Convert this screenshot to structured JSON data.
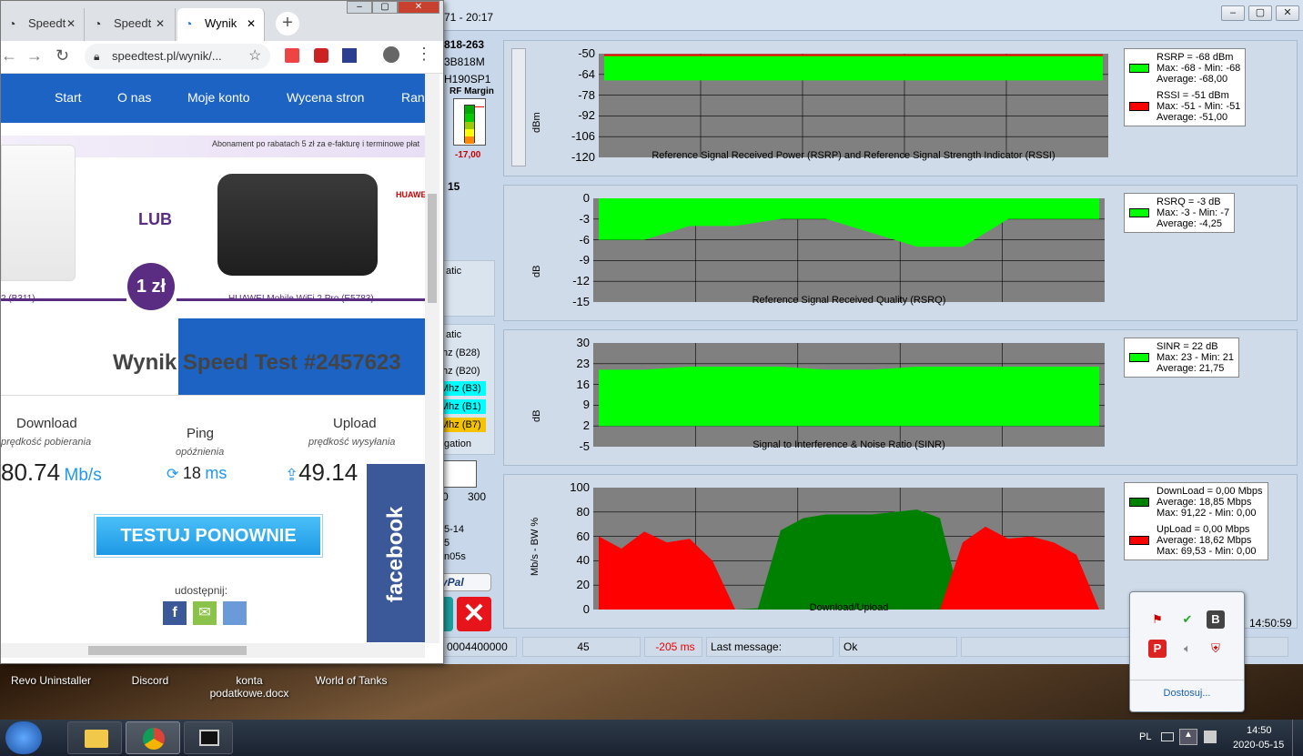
{
  "app": {
    "title": "71 - 20:17",
    "model_id": "818-263",
    "model_a": "3B818M",
    "model_b": "H190SP1",
    "rf_margin_label": "RF Margin",
    "rf_margin_value": "-17,00",
    "side_num": "15",
    "side_atic1": "atic",
    "side_atic2": "atic",
    "band_b28": "hz (B28)",
    "band_b20": "hz (B20)",
    "band_b3": "Mhz (B3)",
    "band_b1": "Mhz (B1)",
    "band_b7": "Mhz (B7)",
    "side_gation": "gation",
    "slider_a": "0",
    "slider_b": "300",
    "side_l1": "5-14",
    "side_l2": "5",
    "side_l3": "n05s",
    "paypal": "yPal",
    "clock": "14:50:59"
  },
  "panels": [
    {
      "ylabel": "dBm",
      "xlabel": "Reference Signal Received Power (RSRP) and Reference Signal Strength Indicator (RSSI)",
      "ticks": [
        "-50",
        "-64",
        "-78",
        "-92",
        "-106",
        "-120"
      ],
      "legend": [
        {
          "color": "#00ff00",
          "l1": "RSRP = -68 dBm",
          "l2": "Max: -68 - Min: -68",
          "l3": "Average: -68,00"
        },
        {
          "color": "#ff0000",
          "l1": "RSSI = -51 dBm",
          "l2": "Max: -51 - Min: -51",
          "l3": "Average: -51,00"
        }
      ]
    },
    {
      "ylabel": "dB",
      "xlabel": "Reference Signal Received Quality (RSRQ)",
      "ticks": [
        "0",
        "-3",
        "-6",
        "-9",
        "-12",
        "-15"
      ],
      "legend": [
        {
          "color": "#00ff00",
          "l1": "RSRQ = -3 dB",
          "l2": "Max: -3 - Min: -7",
          "l3": "Average: -4,25"
        }
      ]
    },
    {
      "ylabel": "dB",
      "xlabel": "Signal to Interference & Noise Ratio (SINR)",
      "ticks": [
        "30",
        "23",
        "16",
        "9",
        "2",
        "-5"
      ],
      "legend": [
        {
          "color": "#00ff00",
          "l1": "SINR = 22 dB",
          "l2": "Max: 23 - Min: 21",
          "l3": "Average: 21,75"
        }
      ]
    },
    {
      "ylabel": "Mb/s - BW %",
      "xlabel": "Download/Upload",
      "ticks": [
        "100",
        "80",
        "60",
        "40",
        "20",
        "0"
      ],
      "legend": [
        {
          "color": "#008000",
          "l1": "DownLoad = 0,00 Mbps",
          "l2": "Average: 18,85 Mbps",
          "l3": "Max: 91,22 - Min: 0,00"
        },
        {
          "color": "#ff0000",
          "l1": "UpLoad = 0,00 Mbps",
          "l2": "Average: 18,62 Mbps",
          "l3": "Max: 69,53 - Min: 0,00"
        }
      ]
    }
  ],
  "chart_data": [
    {
      "type": "area",
      "ylabel": "dBm",
      "xlabel": "Reference Signal Received Power (RSRP) and Reference Signal Strength Indicator (RSSI)",
      "ylim": [
        -120,
        -50
      ],
      "series": [
        {
          "name": "RSRP",
          "values": [
            -68,
            -68,
            -68,
            -68,
            -68,
            -68,
            -68,
            -68,
            -68,
            -68,
            -68,
            -68
          ]
        },
        {
          "name": "RSSI",
          "values": [
            -51,
            -51,
            -51,
            -51,
            -51,
            -51,
            -51,
            -51,
            -51,
            -51,
            -51,
            -51
          ]
        }
      ]
    },
    {
      "type": "area",
      "ylabel": "dB",
      "xlabel": "Reference Signal Received Quality (RSRQ)",
      "ylim": [
        -15,
        0
      ],
      "series": [
        {
          "name": "RSRQ",
          "values": [
            -6,
            -6,
            -4,
            -4,
            -3,
            -3,
            -5,
            -7,
            -7,
            -3,
            -3,
            -3
          ]
        }
      ]
    },
    {
      "type": "area",
      "ylabel": "dB",
      "xlabel": "Signal to Interference & Noise Ratio (SINR)",
      "ylim": [
        -5,
        30
      ],
      "series": [
        {
          "name": "SINR",
          "values": [
            21,
            21,
            22,
            22,
            22,
            21,
            21,
            22,
            22,
            22,
            22,
            22
          ]
        }
      ]
    },
    {
      "type": "area",
      "ylabel": "Mb/s - BW %",
      "xlabel": "Download/Upload",
      "ylim": [
        0,
        100
      ],
      "series": [
        {
          "name": "DownLoad",
          "values": [
            0,
            0,
            0,
            0,
            1,
            0,
            0,
            1,
            65,
            75,
            78,
            78,
            78,
            80,
            82,
            75,
            0,
            0,
            0,
            0,
            0,
            0,
            0
          ]
        },
        {
          "name": "UpLoad",
          "values": [
            60,
            50,
            64,
            55,
            58,
            40,
            0,
            0,
            0,
            0,
            0,
            0,
            0,
            0,
            0,
            0,
            55,
            68,
            58,
            60,
            55,
            45,
            0
          ]
        }
      ]
    }
  ],
  "status": {
    "s1": "0004400000",
    "s2": "45",
    "s3": "-205 ms",
    "s4": "Last message:",
    "s5": "Ok"
  },
  "chrome": {
    "tab1": "Speedt",
    "tab2": "Speedt",
    "tab3": "Wynik",
    "url": "speedtest.pl/wynik/...",
    "nav": [
      "Start",
      "O nas",
      "Moje konto",
      "Wycena stron",
      "Ran"
    ],
    "promo_text": "Abonament po rabatach 5 zł za e-fakturę i terminowe płat",
    "lub": "LUB",
    "price": "1 zł",
    "device_left": "2 (B311)",
    "device_right": "HUAWEI Mobile WiFi 2 Pro (E5783)",
    "huawei": "HUAWEI",
    "result_title": "Wynik Speed Test #2457623",
    "download_label": "Download",
    "download_sub": "prędkość pobierania",
    "download_value": "80.74",
    "download_unit": "Mb/s",
    "ping_label": "Ping",
    "ping_sub": "opóźnienia",
    "ping_value": "18",
    "ping_unit": "ms",
    "upload_label": "Upload",
    "upload_sub": "prędkość wysyłania",
    "upload_value": "49.14",
    "retest": "TESTUJ PONOWNIE",
    "share": "udostępnij:",
    "facebook": "facebook"
  },
  "desktop_icons": [
    "Revo Uninstaller",
    "Discord",
    "konta podatkowe.docx",
    "World of Tanks"
  ],
  "tray": {
    "customize": "Dostosuj..."
  },
  "taskbar": {
    "lang": "PL",
    "time": "14:50",
    "date": "2020-05-15"
  }
}
